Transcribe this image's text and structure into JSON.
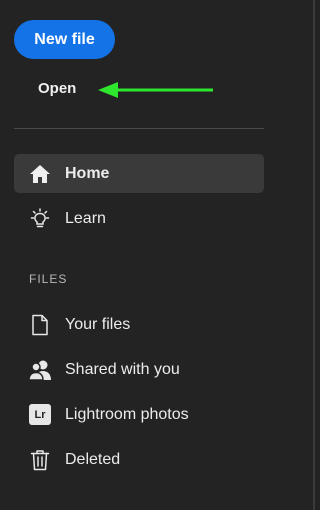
{
  "actions": {
    "new_file_label": "New file",
    "open_label": "Open"
  },
  "nav": {
    "home": "Home",
    "learn": "Learn"
  },
  "files": {
    "section_title": "FILES",
    "your_files": "Your files",
    "shared_with_you": "Shared with you",
    "lightroom_photos": "Lightroom photos",
    "lightroom_badge": "Lr",
    "deleted": "Deleted"
  },
  "colors": {
    "background": "#232323",
    "accent_blue": "#1473e6",
    "active_item": "#3a3a3a",
    "annotation_arrow": "#2ee62e"
  },
  "icons": [
    "home-icon",
    "lightbulb-icon",
    "file-icon",
    "people-icon",
    "lightroom-icon",
    "trash-icon"
  ]
}
